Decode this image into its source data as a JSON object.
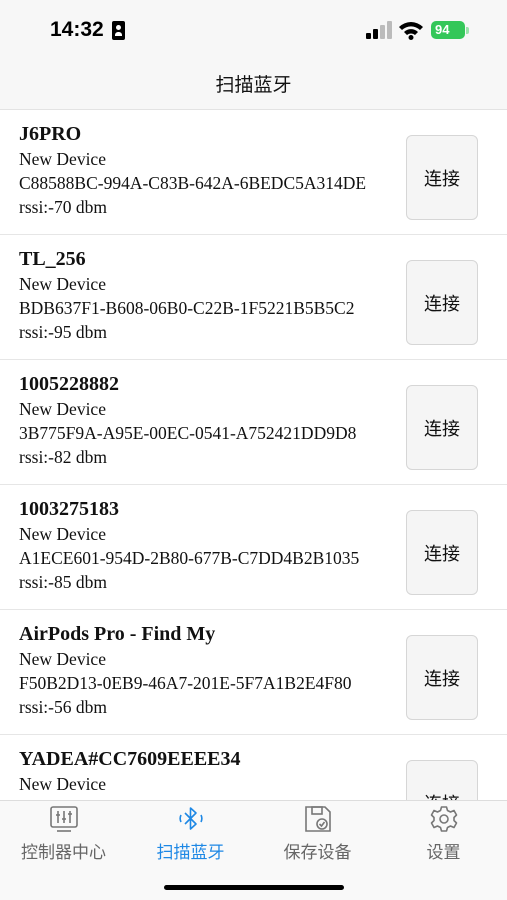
{
  "status_bar": {
    "time": "14:32",
    "battery": "94"
  },
  "nav": {
    "title": "扫描蓝牙"
  },
  "devices": [
    {
      "name": "J6PRO",
      "type": "New Device",
      "uuid": "C88588BC-994A-C83B-642A-6BEDC5A314DE",
      "rssi": "rssi:-70 dbm",
      "connect_label": "连接"
    },
    {
      "name": "TL_256",
      "type": "New Device",
      "uuid": "BDB637F1-B608-06B0-C22B-1F5221B5B5C2",
      "rssi": "rssi:-95 dbm",
      "connect_label": "连接"
    },
    {
      "name": "1005228882",
      "type": "New Device",
      "uuid": "3B775F9A-A95E-00EC-0541-A752421DD9D8",
      "rssi": "rssi:-82 dbm",
      "connect_label": "连接"
    },
    {
      "name": "1003275183",
      "type": "New Device",
      "uuid": "A1ECE601-954D-2B80-677B-C7DD4B2B1035",
      "rssi": "rssi:-85 dbm",
      "connect_label": "连接"
    },
    {
      "name": "AirPods Pro - Find My",
      "type": "New Device",
      "uuid": "F50B2D13-0EB9-46A7-201E-5F7A1B2E4F80",
      "rssi": "rssi:-56 dbm",
      "connect_label": "连接"
    },
    {
      "name": "YADEA#CC7609EEEE34",
      "type": "New Device",
      "uuid": "",
      "rssi": "",
      "connect_label": "连接"
    }
  ],
  "tabs": [
    {
      "label": "控制器中心",
      "icon": "controller-icon",
      "active": false
    },
    {
      "label": "扫描蓝牙",
      "icon": "bluetooth-icon",
      "active": true
    },
    {
      "label": "保存设备",
      "icon": "save-icon",
      "active": false
    },
    {
      "label": "设置",
      "icon": "gear-icon",
      "active": false
    }
  ],
  "colors": {
    "accent": "#1e88e5",
    "battery": "#34c759",
    "inactive": "#666666"
  }
}
